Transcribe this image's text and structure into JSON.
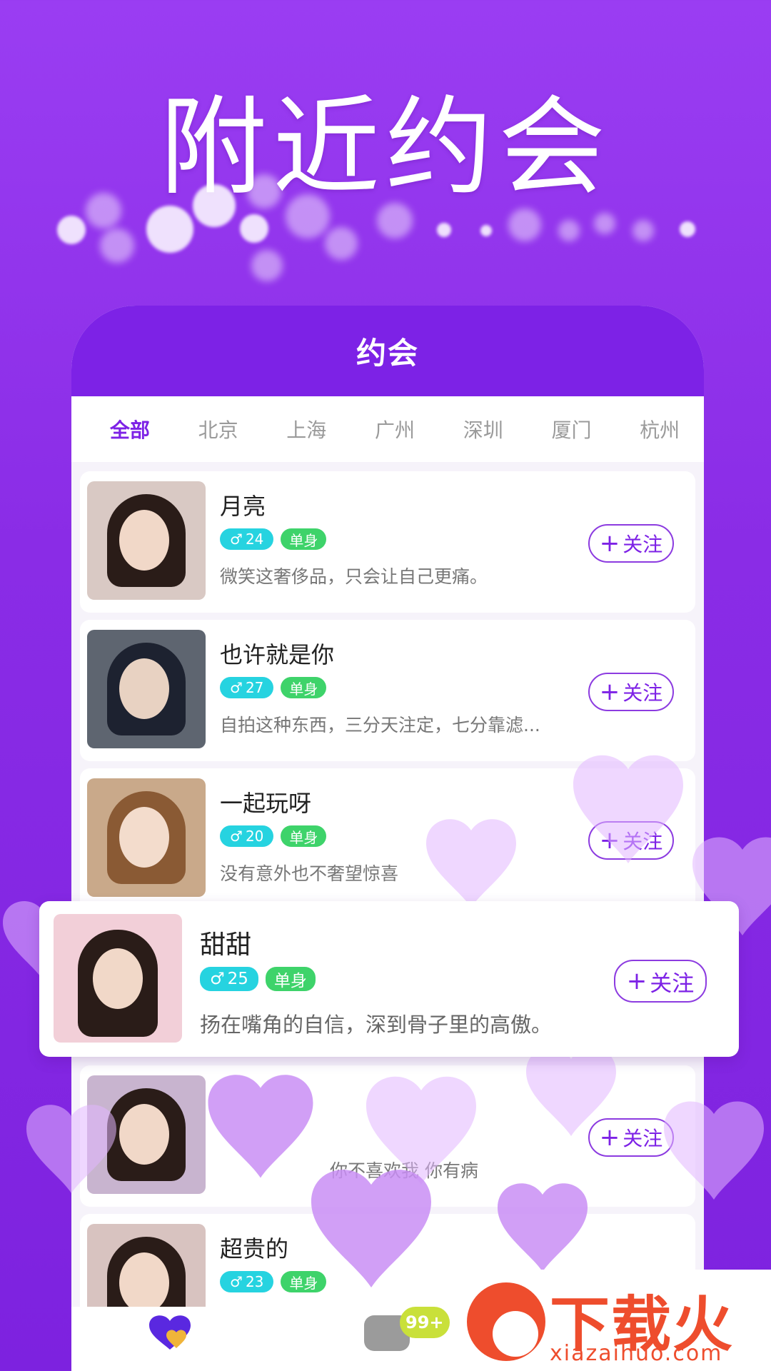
{
  "headline": "附近约会",
  "app": {
    "header_title": "约会",
    "tabs": [
      "全部",
      "北京",
      "上海",
      "广州",
      "深圳",
      "厦门",
      "杭州"
    ],
    "active_tab": "全部",
    "follow_label": "关注",
    "follow_plus": "+",
    "gender_symbol": "♂",
    "users": [
      {
        "name": "月亮",
        "age": "24",
        "status": "单身",
        "bio": "微笑这奢侈品，只会让自己更痛。"
      },
      {
        "name": "也许就是你",
        "age": "27",
        "status": "单身",
        "bio": "自拍这种东西，三分天注定，七分靠滤..."
      },
      {
        "name": "一起玩呀",
        "age": "20",
        "status": "单身",
        "bio": "没有意外也不奢望惊喜"
      },
      {
        "name": "",
        "age": "",
        "status": "",
        "bio": "你不喜欢我 你有病"
      },
      {
        "name": "超贵的",
        "age": "23",
        "status": "单身",
        "bio": ""
      }
    ],
    "featured": {
      "name": "甜甜",
      "age": "25",
      "status": "单身",
      "bio": "扬在嘴角的自信，深到骨子里的高傲。"
    },
    "message_badge": "99+"
  },
  "watermark": {
    "text": "下载火",
    "url": "xiazaihuo.com"
  },
  "colors": {
    "accent": "#7d22e6",
    "age_badge": "#26d3e0",
    "single_badge": "#3ed36a",
    "watermark": "#ee4d2d"
  }
}
